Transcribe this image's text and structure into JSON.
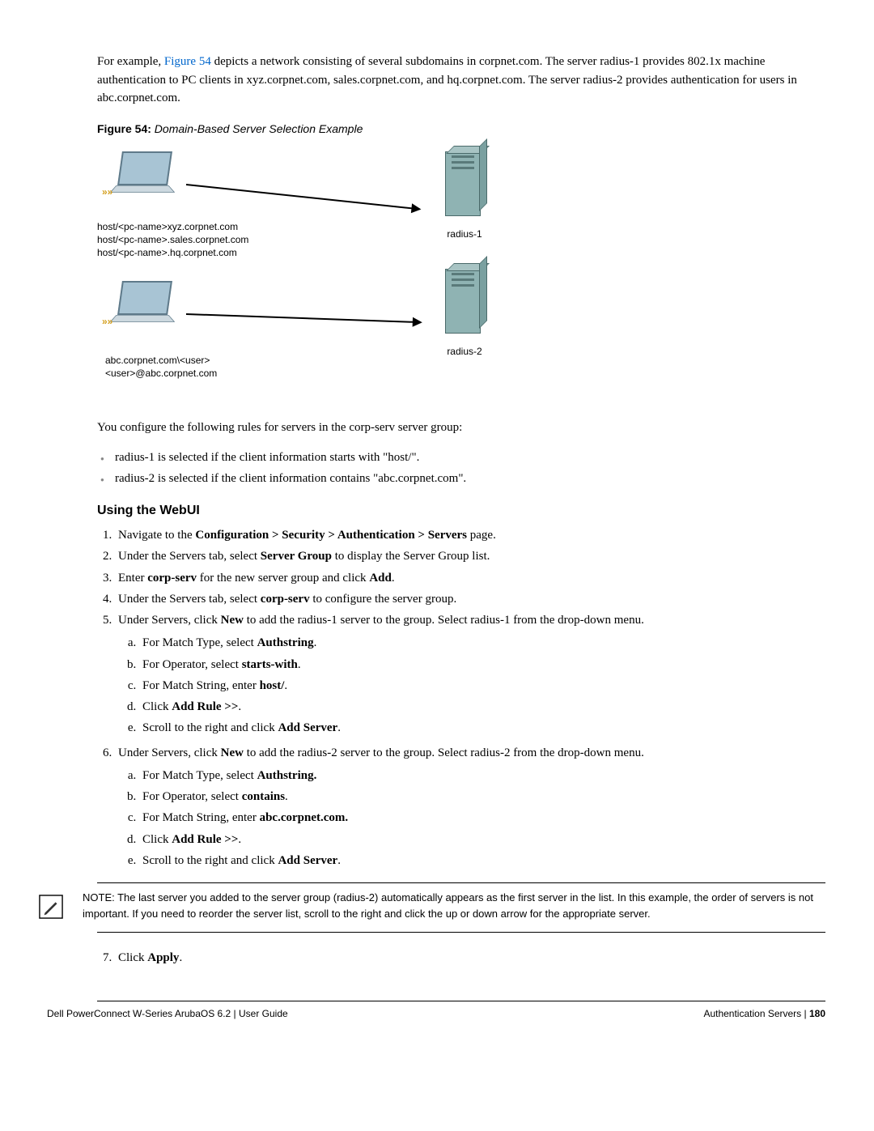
{
  "intro": {
    "prefix": "For example, ",
    "figref": "Figure 54",
    "rest": " depicts a network consisting of several subdomains in corpnet.com. The server radius-1 provides 802.1x machine authentication to PC clients in xyz.corpnet.com, sales.corpnet.com, and hq.corpnet.com. The server radius-2 provides authentication for users in abc.corpnet.com."
  },
  "figure": {
    "label": "Figure 54:",
    "title": " Domain-Based Server Selection Example",
    "laptop1_lines": "host/<pc-name>xyz.corpnet.com\nhost/<pc-name>.sales.corpnet.com\nhost/<pc-name>.hq.corpnet.com",
    "laptop2_lines": "abc.corpnet.com\\<user>\n<user>@abc.corpnet.com",
    "server1": "radius-1",
    "server2": "radius-2"
  },
  "rules_intro": "You configure the following rules for servers in the corp-serv server group:",
  "rules": [
    "radius-1 is selected if the client information starts with \"host/\".",
    "radius-2 is selected if the client information contains \"abc.corpnet.com\"."
  ],
  "section_heading": "Using the WebUI",
  "steps": {
    "s1": {
      "a": "Navigate to the ",
      "b": "Configuration > Security > Authentication > Servers",
      "c": " page."
    },
    "s2": {
      "a": "Under the Servers tab, select ",
      "b": "Server Group",
      "c": " to display the Server Group list."
    },
    "s3": {
      "a": "Enter ",
      "b": "corp-serv",
      "c": " for the new server group and click ",
      "d": "Add",
      "e": "."
    },
    "s4": {
      "a": "Under the Servers tab, select ",
      "b": "corp-serv",
      "c": " to configure the server group."
    },
    "s5": {
      "a": "Under Servers, click ",
      "b": "New",
      "c": " to add the radius-1 server to the group. Select radius-1 from the drop-down menu."
    },
    "s5sub": {
      "a": {
        "a": "For Match Type, select ",
        "b": "Authstring",
        "c": "."
      },
      "b": {
        "a": "For Operator, select ",
        "b": "starts-with",
        "c": "."
      },
      "c": {
        "a": "For Match String, enter ",
        "b": "host/",
        "c": "."
      },
      "d": {
        "a": "Click ",
        "b": "Add Rule >>",
        "c": "."
      },
      "e": {
        "a": "Scroll to the right and click ",
        "b": "Add Server",
        "c": "."
      }
    },
    "s6": {
      "a": "Under Servers, click ",
      "b": "New",
      "c": " to add the radius-2 server to the group. Select radius-2 from the drop-down menu."
    },
    "s6sub": {
      "a": {
        "a": "For Match Type, select ",
        "b": "Authstring.",
        "c": ""
      },
      "b": {
        "a": "For Operator, select ",
        "b": "contains",
        "c": "."
      },
      "c": {
        "a": "For Match String, enter ",
        "b": "abc.corpnet.com.",
        "c": ""
      },
      "d": {
        "a": "Click ",
        "b": "Add Rule >>",
        "c": "."
      },
      "e": {
        "a": "Scroll to the right and click ",
        "b": "Add Server",
        "c": "."
      }
    },
    "s7": {
      "a": "Click ",
      "b": "Apply",
      "c": "."
    }
  },
  "note": "NOTE: The last server you added to the server group (radius-2) automatically appears as the first server in the list. In this example, the order of servers is not important. If you need to reorder the server list, scroll to the right and click the up or down arrow for the appropriate server.",
  "footer": {
    "left": "Dell PowerConnect W-Series ArubaOS 6.2 | User Guide",
    "right_section": "Authentication Servers",
    "right_sep": " | ",
    "right_page": "180"
  }
}
